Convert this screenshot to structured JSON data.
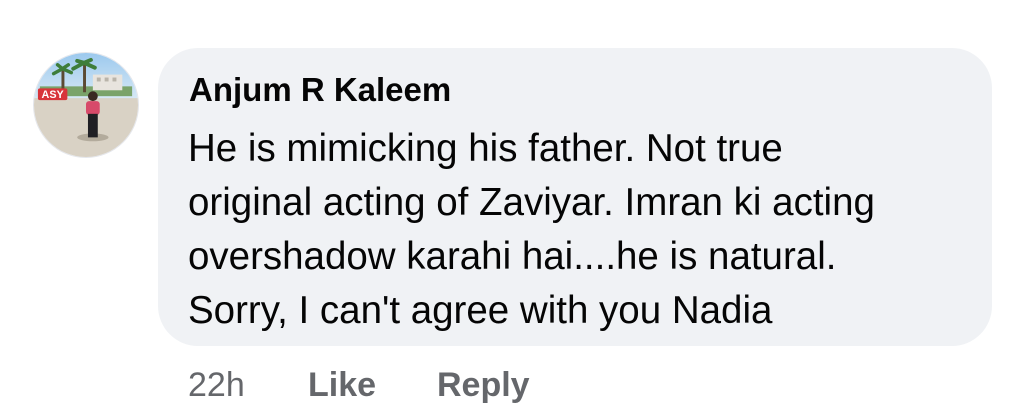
{
  "comment": {
    "author": "Anjum R Kaleem",
    "lines": [
      "He is mimicking his father. Not true",
      "original acting of Zaviyar. Imran ki acting",
      "overshadow karahi hai....he is natural.",
      "Sorry, I can't agree with you Nadia"
    ],
    "avatar_icon": "profile-photo-avatar",
    "avatar_logo_text": "ASY"
  },
  "actions": {
    "time": "22h",
    "like_label": "Like",
    "reply_label": "Reply"
  },
  "colors": {
    "bubble_bg": "#f0f2f5",
    "text_primary": "#050505",
    "text_secondary": "#65676b"
  }
}
